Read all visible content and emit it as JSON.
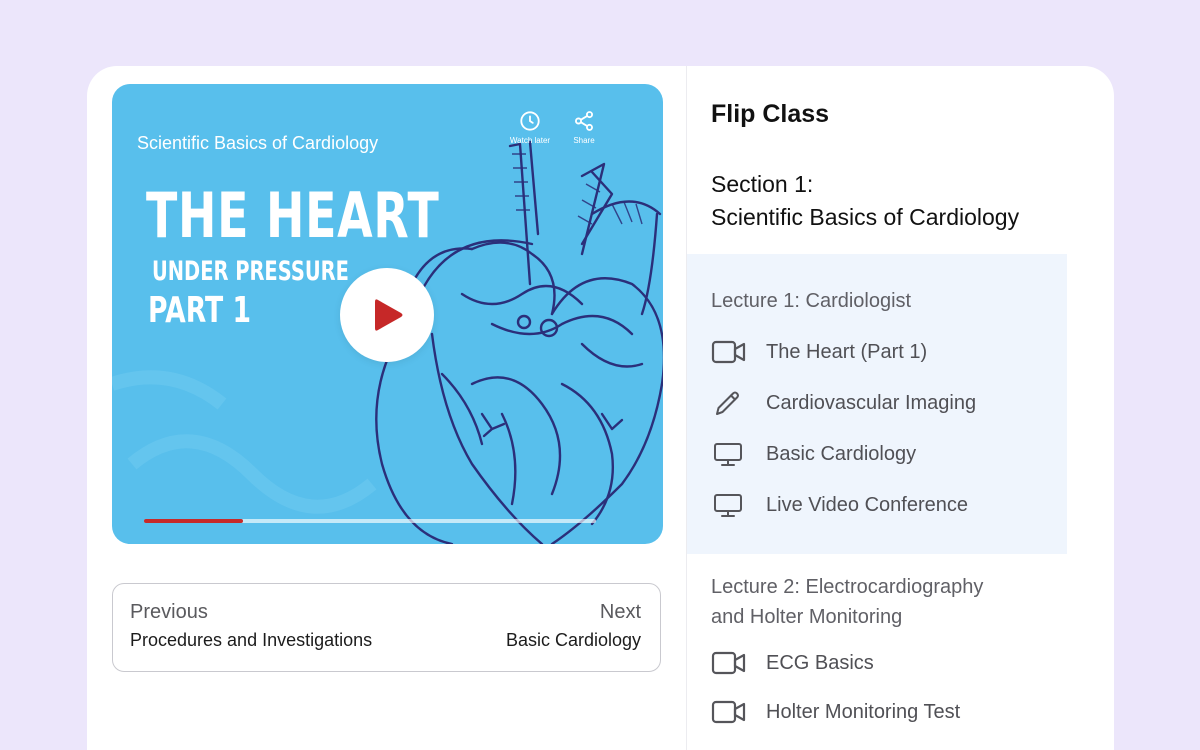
{
  "video": {
    "title": "Scientific Basics of Cardiology",
    "watch_later_label": "Watch later",
    "share_label": "Share",
    "heading_line1": "THE HEART",
    "heading_line2": "UNDER PRESSURE",
    "heading_line3": "PART 1",
    "progress": 0.22,
    "progress_color": "#c72a2a",
    "background_color": "#58bfec",
    "play_color": "#c62828"
  },
  "navigation": {
    "previous_label": "Previous",
    "previous_title": "Procedures and Investigations",
    "next_label": "Next",
    "next_title": "Basic Cardiology"
  },
  "sidebar": {
    "course_title": "Flip Class",
    "section_line1": "Section 1:",
    "section_line2": "Scientific Basics of Cardiology",
    "lectures": [
      {
        "title_line1": "Lecture 1: Cardiologist",
        "items": [
          {
            "label": "The Heart (Part 1)",
            "icon": "video-camera-icon"
          },
          {
            "label": "Cardiovascular Imaging",
            "icon": "pencil-icon"
          },
          {
            "label": "Basic Cardiology",
            "icon": "monitor-icon"
          },
          {
            "label": "Live Video Conference",
            "icon": "monitor-icon"
          }
        ]
      },
      {
        "title_line1": "Lecture 2: Electrocardiography",
        "title_line2": "and Holter Monitoring",
        "items": [
          {
            "label": "ECG Basics",
            "icon": "video-camera-icon"
          },
          {
            "label": "Holter Monitoring Test",
            "icon": "video-camera-icon"
          }
        ]
      }
    ]
  }
}
